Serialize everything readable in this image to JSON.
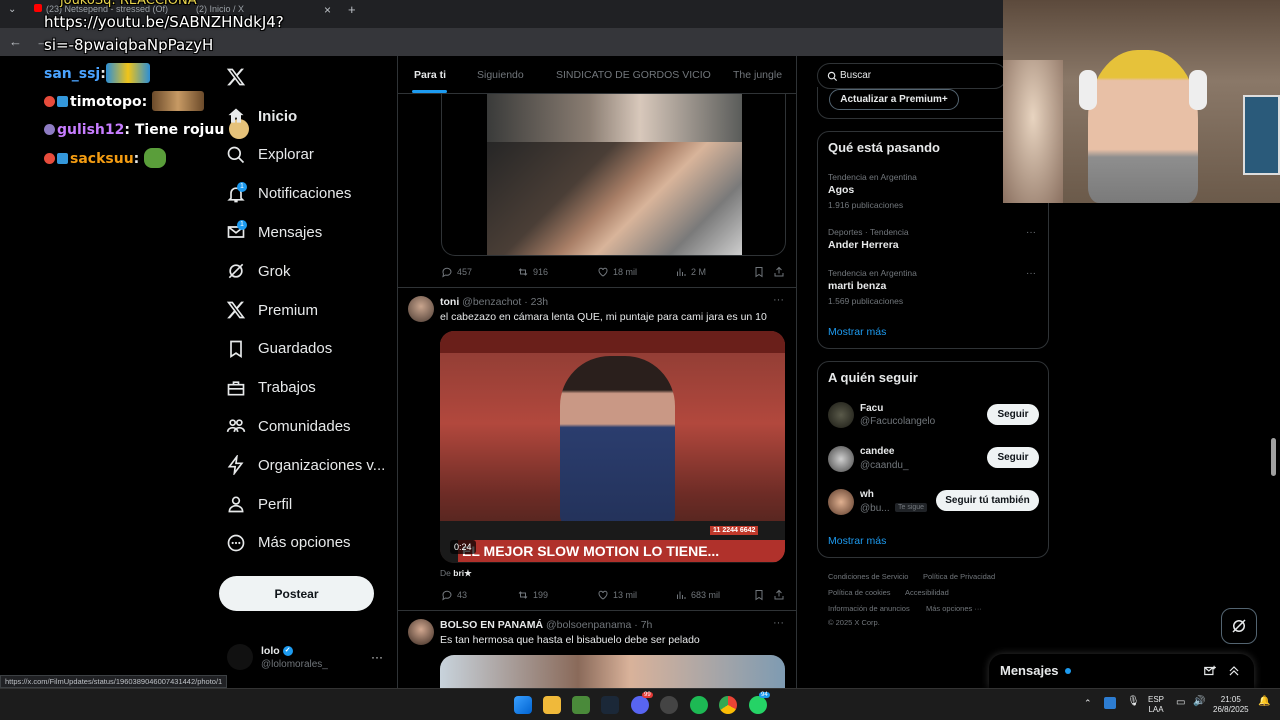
{
  "browser": {
    "tabs": [
      "(23) Netsepend - stressed (Of)",
      "(2) Inicio / X"
    ],
    "tab_close": "×",
    "new_tab": "+",
    "overlay_url_line1": "https://youtu.be/SABNZHNdkJ4?",
    "overlay_url_line2": "si=-8pwaiqbaNpPazyH",
    "overlay_top_fragment": "joukoSq: REACCIONA",
    "status_url": "https://x.com/FilmUpdates/status/1960389046007431442/photo/1"
  },
  "stream_chat": [
    {
      "user": "san_ssj",
      "sep": ":",
      "msg": "",
      "color": "#4aa3ff"
    },
    {
      "user": "timotopo",
      "sep": ":",
      "msg": "",
      "color": "#ffffff"
    },
    {
      "user": "gulish12",
      "sep": ":",
      "msg": " Tiene rojuu",
      "color": "#c77dff"
    },
    {
      "user": "sacksuu",
      "sep": ":",
      "msg": "",
      "color": "#f39c12"
    }
  ],
  "sidebar": {
    "items": [
      {
        "label": "Inicio",
        "icon": "home-icon",
        "active": true
      },
      {
        "label": "Explorar",
        "icon": "search-icon"
      },
      {
        "label": "Notificaciones",
        "icon": "bell-icon",
        "badge": "1"
      },
      {
        "label": "Mensajes",
        "icon": "mail-icon",
        "badge": "1"
      },
      {
        "label": "Grok",
        "icon": "grok-icon"
      },
      {
        "label": "Premium",
        "icon": "x-logo-icon"
      },
      {
        "label": "Guardados",
        "icon": "bookmark-icon"
      },
      {
        "label": "Trabajos",
        "icon": "briefcase-icon"
      },
      {
        "label": "Comunidades",
        "icon": "people-icon"
      },
      {
        "label": "Organizaciones v...",
        "icon": "lightning-icon"
      },
      {
        "label": "Perfil",
        "icon": "person-icon"
      },
      {
        "label": "Más opciones",
        "icon": "more-circle-icon"
      }
    ],
    "post_button": "Postear",
    "account": {
      "name": "lolo",
      "handle": "@lolomorales_",
      "more": "···"
    }
  },
  "feed": {
    "tabs": [
      "Para ti",
      "Siguiendo",
      "SINDICATO DE GORDOS VICIO",
      "The jungle"
    ],
    "post1_stats": {
      "replies": "457",
      "reposts": "916",
      "likes": "18 mil",
      "views": "2 M"
    },
    "post2": {
      "name": "toni",
      "handle": "@benzachot",
      "time": "· 23h",
      "more": "···",
      "text": "el cabezazo en cámara lenta QUE, mi puntaje para cami jara es un 10",
      "video_banner": "EL MEJOR SLOW MOTION LO TIENE...",
      "video_time": "0:24",
      "phone": "11 2244 6642",
      "from_label": "De",
      "from_user": "bri★",
      "stats": {
        "replies": "43",
        "reposts": "199",
        "likes": "13 mil",
        "views": "683 mil"
      }
    },
    "post3": {
      "name": "BOLSO EN PANAMÁ",
      "handle": "@bolsoenpanama",
      "time": "· 7h",
      "more": "···",
      "text": "Es tan hermosa que hasta el bisabuelo debe ser pelado"
    }
  },
  "right": {
    "search_placeholder": "Buscar",
    "premium_button": "Actualizar a Premium+",
    "trends_title": "Qué está pasando",
    "trends": [
      {
        "meta": "Tendencia en Argentina",
        "name": "Agos",
        "count": "1.916 publicaciones"
      },
      {
        "meta": "Deportes · Tendencia",
        "name": "Ander Herrera",
        "count": ""
      },
      {
        "meta": "Tendencia en Argentina",
        "name": "marti benza",
        "count": "1.569 publicaciones"
      }
    ],
    "trend_more": "···",
    "show_more": "Mostrar más",
    "follow_title": "A quién seguir",
    "follow": [
      {
        "name": "Facu",
        "handle": "@Facucolangelo",
        "button": "Seguir",
        "tag": ""
      },
      {
        "name": "candee",
        "handle": "@caandu_",
        "button": "Seguir",
        "tag": ""
      },
      {
        "name": "wh",
        "handle": "@bu...",
        "button": "Seguir tú también",
        "tag": "Te sigue"
      }
    ],
    "follow_more": "Mostrar más",
    "footer": [
      "Condiciones de Servicio",
      "Política de Privacidad",
      "Política de cookies",
      "Accesibilidad",
      "Información de anuncios",
      "Más opciones ···",
      "© 2025 X Corp."
    ],
    "messages_label": "Mensajes"
  },
  "taskbar": {
    "lang_top": "ESP",
    "lang_bottom": "LAA",
    "time": "21:05",
    "date": "26/8/2025",
    "badges": {
      "discord": "99",
      "whatsapp": "94"
    }
  }
}
